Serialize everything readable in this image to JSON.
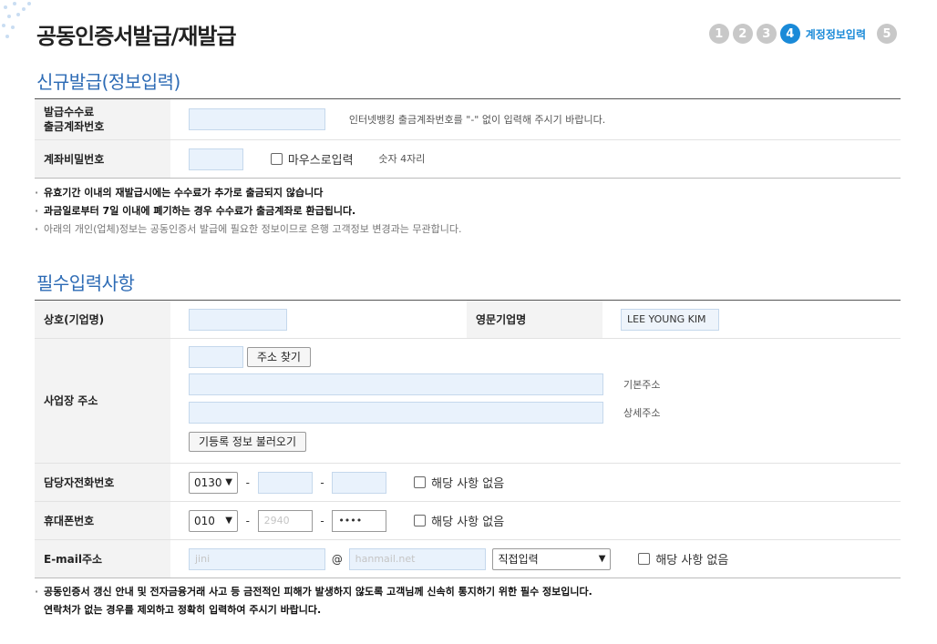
{
  "header": {
    "title": "공동인증서발급/재발급",
    "steps": [
      "1",
      "2",
      "3",
      "4",
      "5"
    ],
    "active_step_label": "계정정보입력"
  },
  "section1": {
    "title": "신규발급(정보입력)",
    "rows": {
      "fee_account_label_1": "발급수수료",
      "fee_account_label_2": "출금계좌번호",
      "fee_account_hint": "인터넷뱅킹 출금계좌번호를 \"-\" 없이 입력해 주시기 바랍니다.",
      "password_label": "계좌비밀번호",
      "mouse_input_label": "마우스로입력",
      "password_hint": "숫자 4자리"
    },
    "notes": [
      "유효기간 이내의 재발급시에는 수수료가 추가로 출금되지 않습니다",
      "과금일로부터 7일 이내에 폐기하는 경우 수수료가 출금계좌로 환급됩니다.",
      "아래의 개인(업체)정보는 공동인증서 발급에 필요한 정보이므로 은행 고객정보 변경과는 무관합니다."
    ]
  },
  "section2": {
    "title": "필수입력사항",
    "company_label": "상호(기업명)",
    "english_name_label": "영문기업명",
    "english_name_value": "LEE YOUNG KIM",
    "address_label": "사업장 주소",
    "find_address_button": "주소 찾기",
    "basic_address_label": "기본주소",
    "detail_address_label": "상세주소",
    "load_registered_button": "기등록 정보 불러오기",
    "contact_phone_label": "담당자전화번호",
    "contact_phone_prefix": "0130",
    "none_label": "해당 사항 없음",
    "mobile_label": "휴대폰번호",
    "mobile_prefix": "010",
    "mobile_middle": "2940",
    "mobile_last": "••••",
    "email_label": "E-mail주소",
    "email_id": "jini",
    "email_at": "@",
    "email_domain": "hanmail.net",
    "email_select": "직접입력"
  },
  "footer_notes": [
    "공동인증서 갱신 안내 및 전자금융거래 사고 등 금전적인 피해가 발생하지 않도록 고객님께 신속히 통지하기 위한 필수 정보입니다.",
    "연락처가 없는 경우를 제외하고 정확히 입력하여 주시기 바랍니다."
  ],
  "colors": {
    "accent": "#1a8ad8",
    "section_title": "#2d6bb5",
    "input_bg": "#e9f2fc"
  }
}
